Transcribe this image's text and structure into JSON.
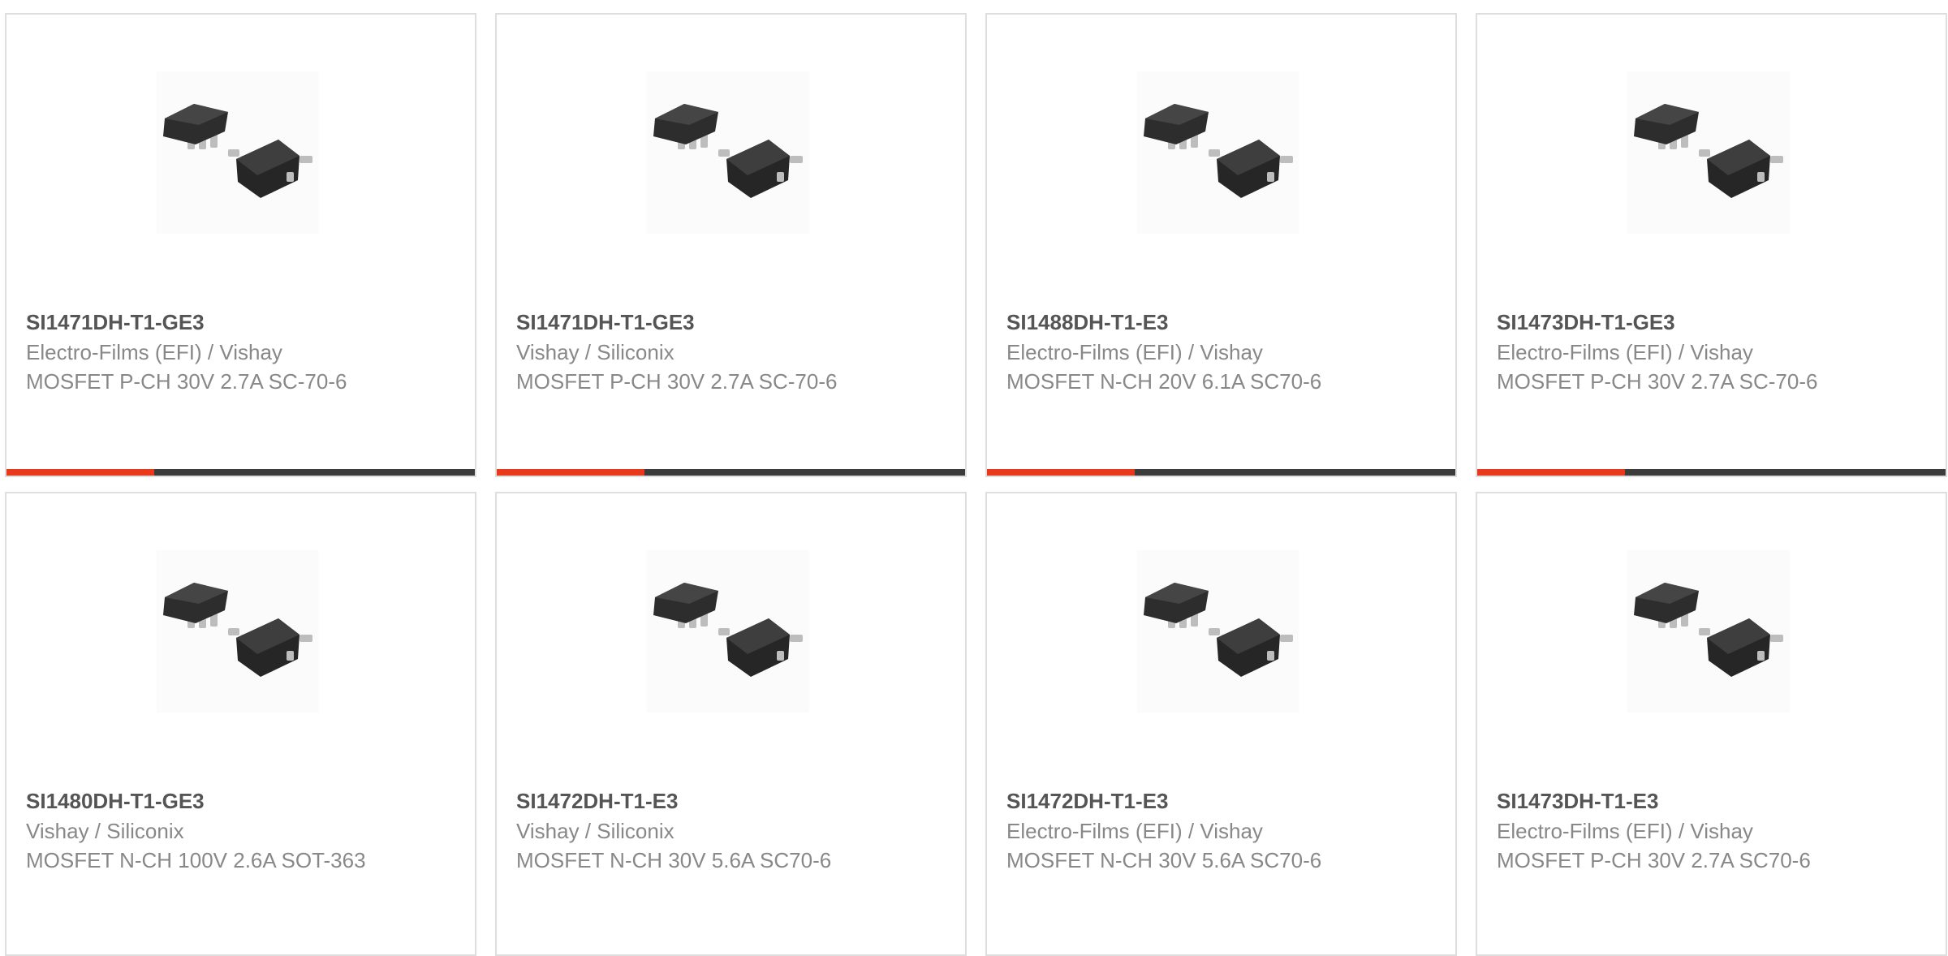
{
  "accent_color": "#e8391c",
  "bar_color": "#3c3c3c",
  "products": [
    {
      "part": "SI1471DH-T1-GE3",
      "manufacturer": "Electro-Films (EFI) / Vishay",
      "description": "MOSFET P-CH 30V 2.7A SC-70-6",
      "image_icon": "sc70-6-chip-image"
    },
    {
      "part": "SI1471DH-T1-GE3",
      "manufacturer": "Vishay / Siliconix",
      "description": "MOSFET P-CH 30V 2.7A SC-70-6",
      "image_icon": "sc70-6-chip-image"
    },
    {
      "part": "SI1488DH-T1-E3",
      "manufacturer": "Electro-Films (EFI) / Vishay",
      "description": "MOSFET N-CH 20V 6.1A SC70-6",
      "image_icon": "sc70-6-chip-image"
    },
    {
      "part": "SI1473DH-T1-GE3",
      "manufacturer": "Electro-Films (EFI) / Vishay",
      "description": "MOSFET P-CH 30V 2.7A SC-70-6",
      "image_icon": "sc70-6-chip-image"
    },
    {
      "part": "SI1480DH-T1-GE3",
      "manufacturer": "Vishay / Siliconix",
      "description": "MOSFET N-CH 100V 2.6A SOT-363",
      "image_icon": "sc70-6-chip-image"
    },
    {
      "part": "SI1472DH-T1-E3",
      "manufacturer": "Vishay / Siliconix",
      "description": "MOSFET N-CH 30V 5.6A SC70-6",
      "image_icon": "sc70-6-chip-image"
    },
    {
      "part": "SI1472DH-T1-E3",
      "manufacturer": "Electro-Films (EFI) / Vishay",
      "description": "MOSFET N-CH 30V 5.6A SC70-6",
      "image_icon": "sc70-6-chip-image"
    },
    {
      "part": "SI1473DH-T1-E3",
      "manufacturer": "Electro-Films (EFI) / Vishay",
      "description": "MOSFET P-CH 30V 2.7A SC70-6",
      "image_icon": "sc70-6-chip-image"
    }
  ]
}
